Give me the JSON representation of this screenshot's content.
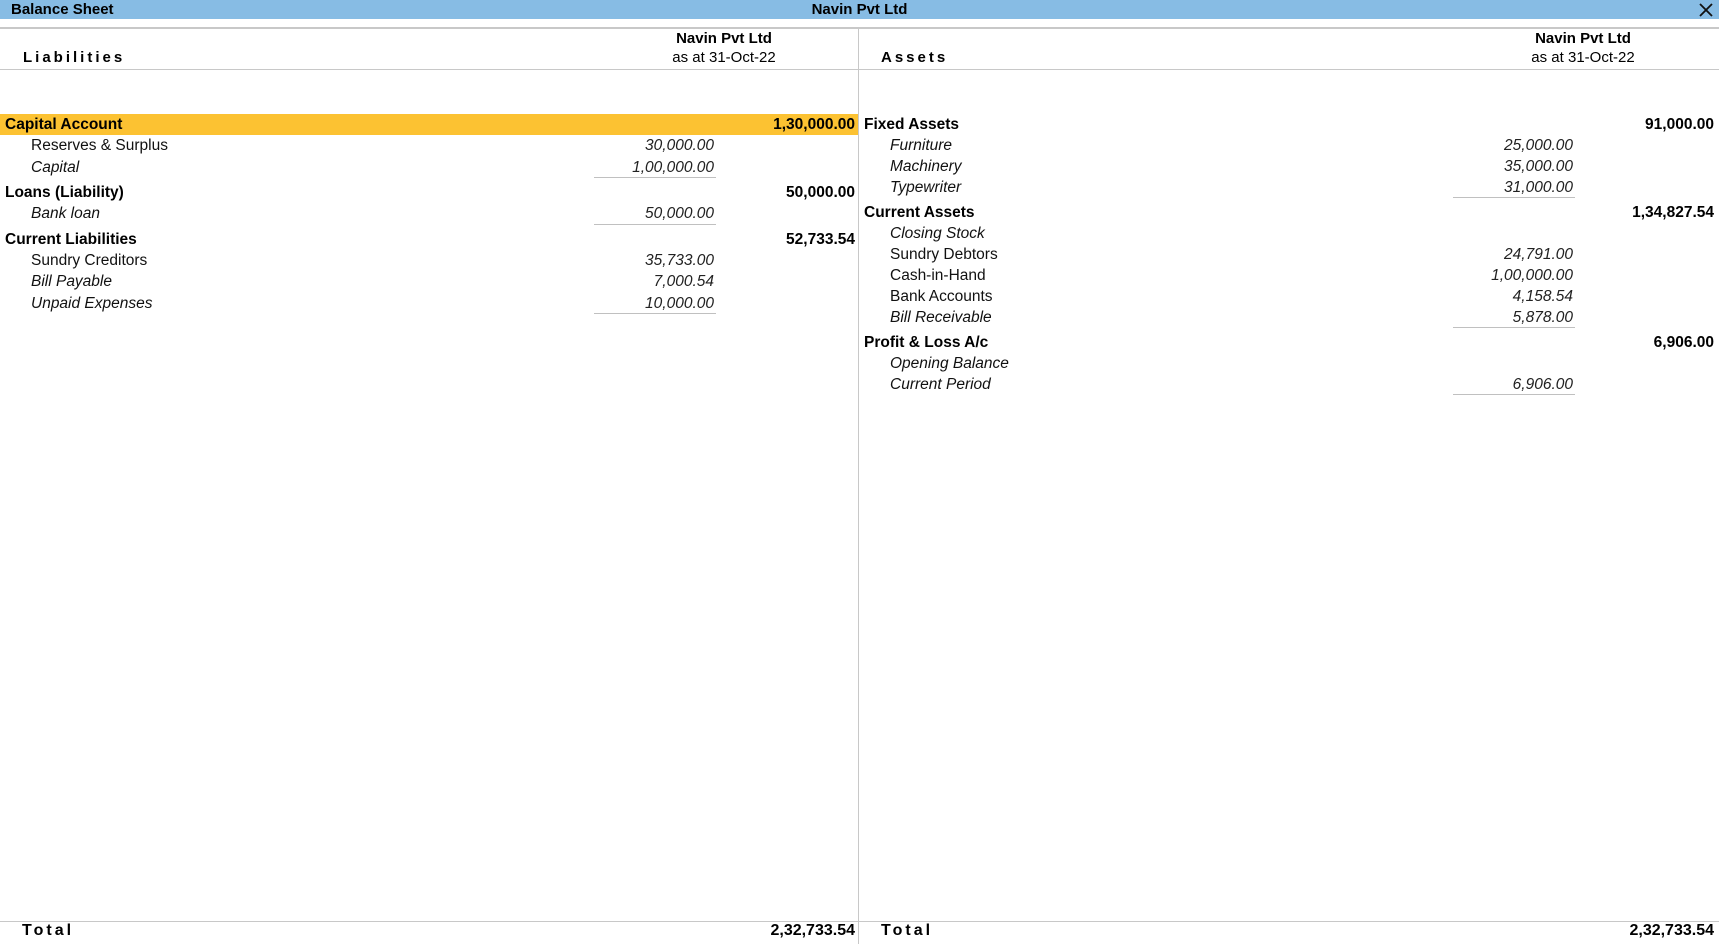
{
  "titlebar": {
    "title": "Balance Sheet",
    "company": "Navin Pvt Ltd",
    "close_icon": "close-icon"
  },
  "liabilities": {
    "label": "Liabilities",
    "column": {
      "company": "Navin Pvt Ltd",
      "period": "as at 31-Oct-22"
    },
    "groups": [
      {
        "name": "Capital Account",
        "total": "1,30,000.00",
        "selected": true,
        "items": [
          {
            "name": "Reserves & Surplus",
            "amount": "30,000.00",
            "italic": false
          },
          {
            "name": "Capital",
            "amount": "1,00,000.00",
            "italic": true
          }
        ]
      },
      {
        "name": "Loans (Liability)",
        "total": "50,000.00",
        "selected": false,
        "items": [
          {
            "name": "Bank loan",
            "amount": "50,000.00",
            "italic": true
          }
        ]
      },
      {
        "name": "Current Liabilities",
        "total": "52,733.54",
        "selected": false,
        "items": [
          {
            "name": "Sundry Creditors",
            "amount": "35,733.00",
            "italic": false
          },
          {
            "name": "Bill Payable",
            "amount": "7,000.54",
            "italic": true
          },
          {
            "name": "Unpaid Expenses",
            "amount": "10,000.00",
            "italic": true
          }
        ]
      }
    ],
    "footer": {
      "label": "Total",
      "total": "2,32,733.54"
    }
  },
  "assets": {
    "label": "Assets",
    "column": {
      "company": "Navin Pvt Ltd",
      "period": "as at 31-Oct-22"
    },
    "groups": [
      {
        "name": "Fixed Assets",
        "total": "91,000.00",
        "items": [
          {
            "name": "Furniture",
            "amount": "25,000.00",
            "italic": true
          },
          {
            "name": "Machinery",
            "amount": "35,000.00",
            "italic": true
          },
          {
            "name": "Typewriter",
            "amount": "31,000.00",
            "italic": true
          }
        ]
      },
      {
        "name": "Current Assets",
        "total": "1,34,827.54",
        "items": [
          {
            "name": "Closing Stock",
            "amount": "",
            "italic": true
          },
          {
            "name": "Sundry Debtors",
            "amount": "24,791.00",
            "italic": false
          },
          {
            "name": "Cash-in-Hand",
            "amount": "1,00,000.00",
            "italic": false
          },
          {
            "name": "Bank Accounts",
            "amount": "4,158.54",
            "italic": false
          },
          {
            "name": "Bill Receivable",
            "amount": "5,878.00",
            "italic": true
          }
        ]
      },
      {
        "name": "Profit & Loss A/c",
        "total": "6,906.00",
        "items": [
          {
            "name": "Opening Balance",
            "amount": "",
            "italic": true
          },
          {
            "name": "Current Period",
            "amount": "6,906.00",
            "italic": true
          }
        ]
      }
    ],
    "footer": {
      "label": "Total",
      "total": "2,32,733.54"
    }
  },
  "colors": {
    "titlebar": "#87bce4",
    "selected_row": "#fcc232"
  }
}
